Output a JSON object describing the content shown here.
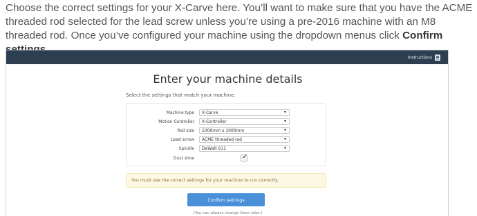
{
  "intro": {
    "text": "Choose the correct settings for your X-Carve here. You’ll want to make sure that you have the ACME threaded rod selected for the lead screw unless you’re using a pre-2016 machine with an M8 threaded rod. Once you’ve configured your machine using the dropdown menus click ",
    "bold": "Confirm settings",
    "end": "."
  },
  "topbar": {
    "instructions_label": "Instructions",
    "bg_color": "#2c3e50"
  },
  "form": {
    "title": "Enter your machine details",
    "subtitle": "Select the settings that match your machine.",
    "fields": [
      {
        "label": "Machine type",
        "value": "X-Carve"
      },
      {
        "label": "Motion Controller",
        "value": "X-Controller"
      },
      {
        "label": "Rail size",
        "value": "1000mm x 1000mm"
      },
      {
        "label": "Lead screw",
        "value": "ACME threaded rod"
      },
      {
        "label": "Spindle",
        "value": "DeWalt 611"
      }
    ],
    "dust_shoe": {
      "label": "Dust shoe",
      "checked": true
    },
    "alert": "You must use the correct settings for your machine to run correctly.",
    "confirm_label": "Confirm settings",
    "note": "(You can always change them later.)",
    "accent_color": "#4a90d9",
    "alert_bg": "#fcf8e3"
  }
}
